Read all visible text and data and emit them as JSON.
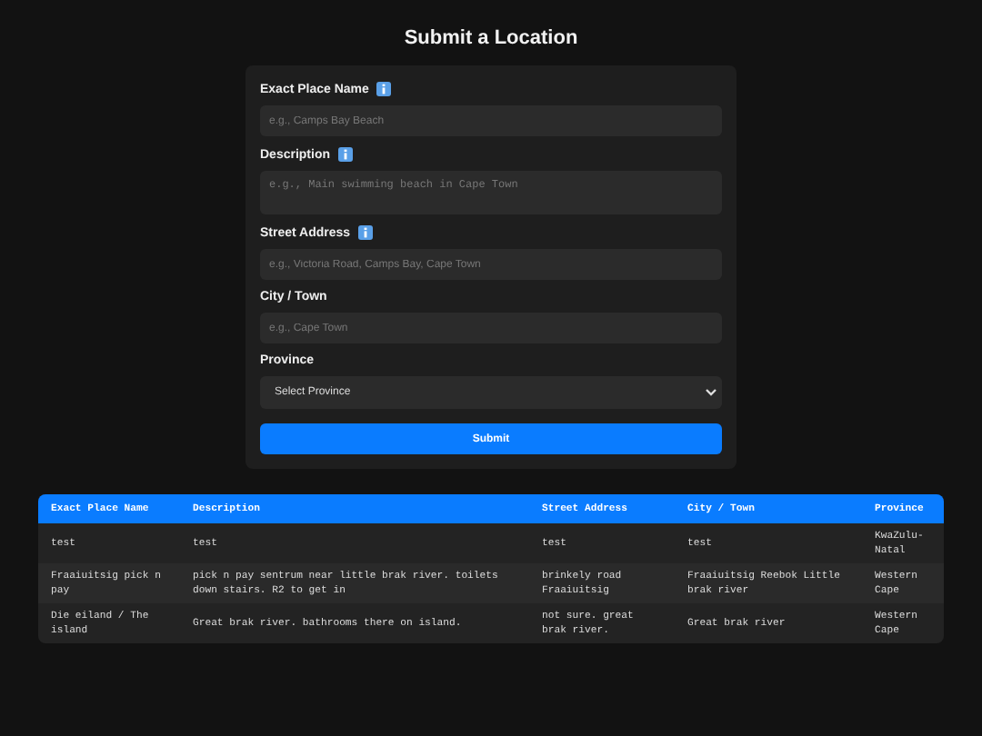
{
  "title": "Submit a Location",
  "form": {
    "fields": [
      {
        "kind": "input",
        "label": "Exact Place Name",
        "info": true,
        "placeholder": "e.g., Camps Bay Beach"
      },
      {
        "kind": "textarea",
        "label": "Description",
        "info": true,
        "placeholder": "e.g., Main swimming beach in Cape Town"
      },
      {
        "kind": "input",
        "label": "Street Address",
        "info": true,
        "placeholder": "e.g., Victoria Road, Camps Bay, Cape Town"
      },
      {
        "kind": "input",
        "label": "City / Town",
        "info": false,
        "placeholder": "e.g., Cape Town"
      },
      {
        "kind": "select",
        "label": "Province",
        "info": false,
        "value": "Select Province"
      }
    ],
    "submit": "Submit"
  },
  "table": {
    "columns": [
      "Exact Place Name",
      "Description",
      "Street Address",
      "City / Town",
      "Province"
    ],
    "rows": [
      [
        "test",
        "test",
        "test",
        "test",
        "KwaZulu-Natal"
      ],
      [
        "Fraaiuitsig pick n pay",
        "pick n pay sentrum near little brak river. toilets down stairs. R2 to get in",
        "brinkely road Fraaiuitsig",
        "Fraaiuitsig Reebok Little brak river",
        "Western Cape"
      ],
      [
        "Die eiland / The island",
        "Great brak river. bathrooms there on island.",
        "not sure. great brak river.",
        "Great brak river",
        "Western Cape"
      ]
    ]
  }
}
